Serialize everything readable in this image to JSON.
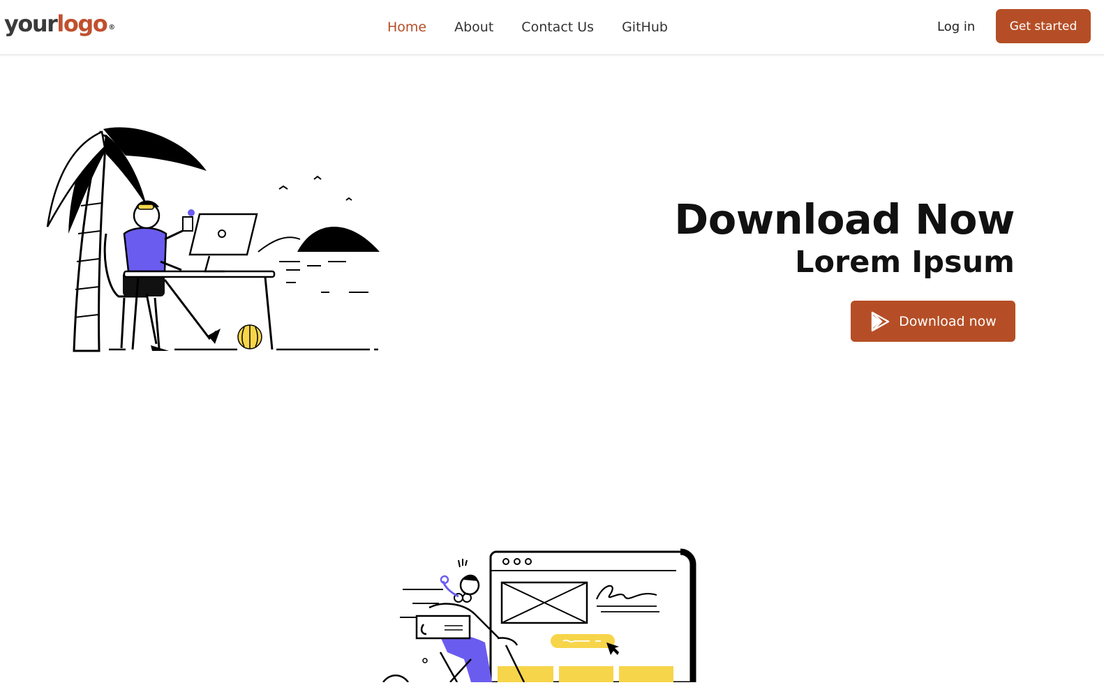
{
  "nav": {
    "logo": {
      "word1": "your",
      "word2": "logo",
      "mark": "®"
    },
    "links": [
      "Home",
      "About",
      "Contact Us",
      "GitHub"
    ],
    "active_link": "Home",
    "login_label": "Log in",
    "cta_label": "Get started"
  },
  "hero": {
    "title": "Download Now",
    "subtitle": "Lorem Ipsum",
    "button_label": "Download now",
    "button_icon": "play-store-icon"
  },
  "colors": {
    "accent": "#b54e26",
    "logo_accent": "#c0502e",
    "illustration_purple": "#6b5cf0",
    "illustration_yellow": "#f7d54a"
  }
}
